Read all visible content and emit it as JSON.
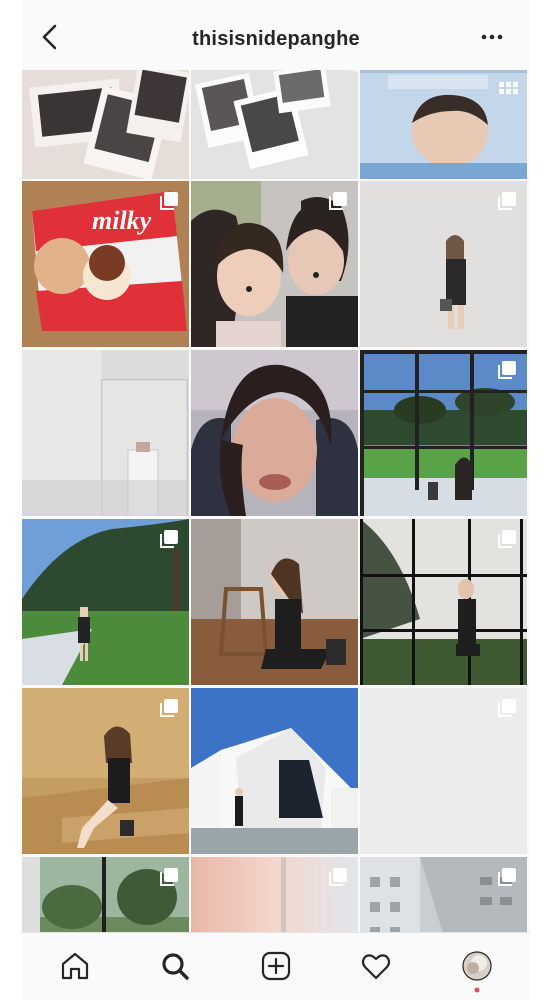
{
  "header": {
    "username": "thisisnidepanghe",
    "back_icon": "chevron-left-icon",
    "more_icon": "ellipsis-horizontal-icon"
  },
  "grid": {
    "rows": 6,
    "columns": 3,
    "tiles": [
      {
        "name": "polaroids-bed",
        "multi": false
      },
      {
        "name": "polaroids-white-sheet",
        "multi": false
      },
      {
        "name": "sleeping-child",
        "multi": false,
        "badge": "grid-icon"
      },
      {
        "name": "milky-candy",
        "multi": true
      },
      {
        "name": "couple-selfie",
        "multi": true
      },
      {
        "name": "glitter-wall-girl",
        "multi": true
      },
      {
        "name": "glass-case",
        "multi": false
      },
      {
        "name": "blurry-selfie",
        "multi": false
      },
      {
        "name": "window-garden",
        "multi": true
      },
      {
        "name": "park-lawn-girl",
        "multi": true
      },
      {
        "name": "chair-girl",
        "multi": false
      },
      {
        "name": "tree-window-girl",
        "multi": true
      },
      {
        "name": "wooden-step-girl",
        "multi": true
      },
      {
        "name": "white-house-girl",
        "multi": false
      },
      {
        "name": "empty-light-tile",
        "multi": true
      },
      {
        "name": "forest-window",
        "multi": true
      },
      {
        "name": "pink-gradient",
        "multi": true
      },
      {
        "name": "building-facade",
        "multi": true
      }
    ]
  },
  "bottom_nav": {
    "items": [
      {
        "name": "home",
        "icon": "home-icon"
      },
      {
        "name": "search",
        "icon": "search-icon"
      },
      {
        "name": "new-post",
        "icon": "plus-square-icon"
      },
      {
        "name": "activity",
        "icon": "heart-icon"
      },
      {
        "name": "profile",
        "icon": "avatar-icon"
      }
    ]
  },
  "colors": {
    "background": "#fafafa",
    "text": "#262626",
    "divider": "#e3e3e3"
  }
}
